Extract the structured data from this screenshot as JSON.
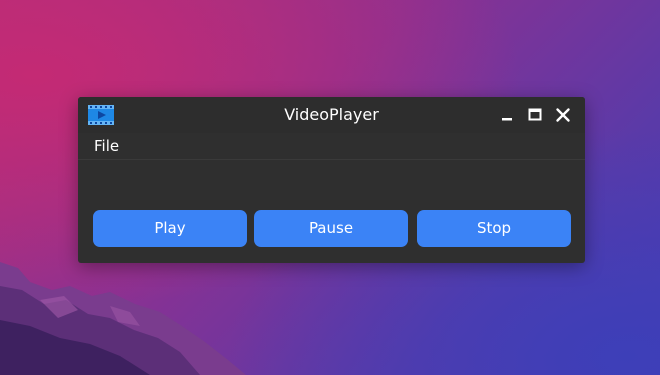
{
  "window": {
    "title": "VideoPlayer",
    "app_icon": "video-player-icon",
    "controls": {
      "minimize_icon": "minimize-icon",
      "maximize_icon": "maximize-icon",
      "close_icon": "close-icon"
    }
  },
  "menubar": {
    "items": [
      {
        "label": "File"
      }
    ]
  },
  "controls": {
    "play_label": "Play",
    "pause_label": "Pause",
    "stop_label": "Stop"
  },
  "colors": {
    "accent": "#3b83f6",
    "window_bg": "#2f2f2f",
    "text": "#ffffff"
  }
}
